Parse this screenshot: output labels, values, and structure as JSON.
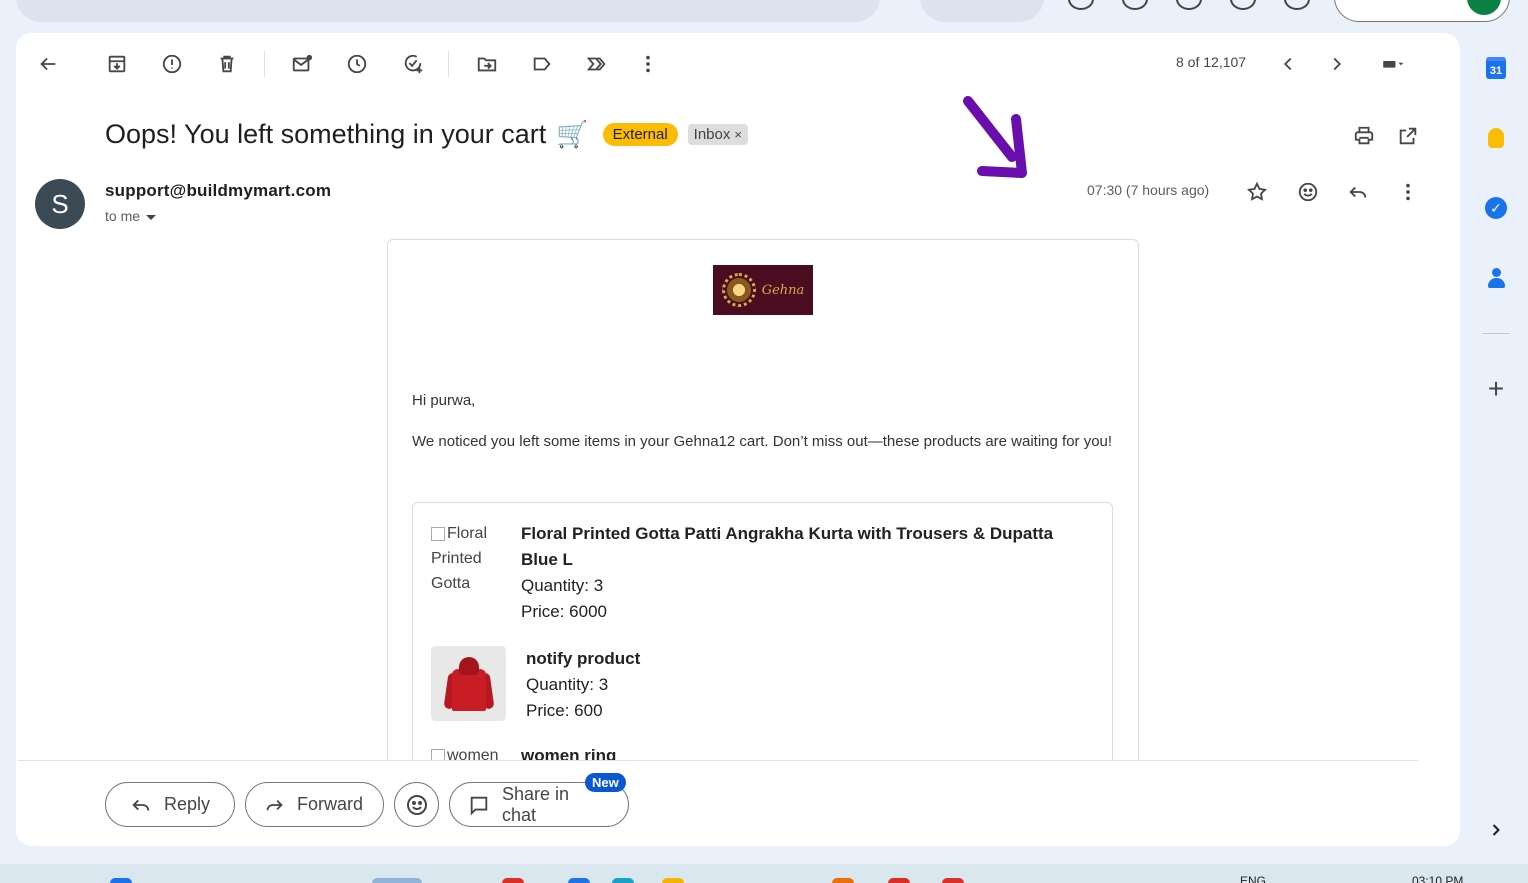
{
  "toolbar": {
    "pager": "8 of 12,107"
  },
  "email": {
    "subject": "Oops! You left something in your cart",
    "subject_emoji": "🛒",
    "labels": {
      "external": "External",
      "inbox": "Inbox",
      "inbox_remove": "×"
    },
    "sender_initial": "S",
    "sender": "support@buildmymart.com",
    "recipient": "to me",
    "timestamp": "07:30 (7 hours ago)"
  },
  "body": {
    "brand": "Gehna",
    "greeting": "Hi purwa,",
    "intro": "We noticed you left some items in your Gehna12 cart. Don’t miss out—these products are waiting for you!",
    "items": [
      {
        "img_alt_1": "Floral",
        "img_alt_2": "Printed",
        "img_alt_3": "Gotta",
        "name_1": "Floral Printed Gotta Patti Angrakha Kurta with Trousers & Dupatta",
        "name_2": "Blue L",
        "quantity": "Quantity: 3",
        "price": "Price: 6000"
      },
      {
        "name": "notify product",
        "quantity": "Quantity: 3",
        "price": "Price: 600"
      },
      {
        "img_alt": "women",
        "name": "women ring"
      }
    ]
  },
  "footer": {
    "reply": "Reply",
    "forward": "Forward",
    "share": "Share in chat",
    "new_badge": "New"
  },
  "side_panel": {
    "calendar_day": "31",
    "tasks_check": "✓",
    "add": "+"
  },
  "taskbar": {
    "lang": "ENG",
    "time": "03:10 PM"
  },
  "colors": {
    "external_label": "#fbbc04",
    "annotation_arrow": "#6a0dad",
    "new_badge": "#0b57d0"
  }
}
